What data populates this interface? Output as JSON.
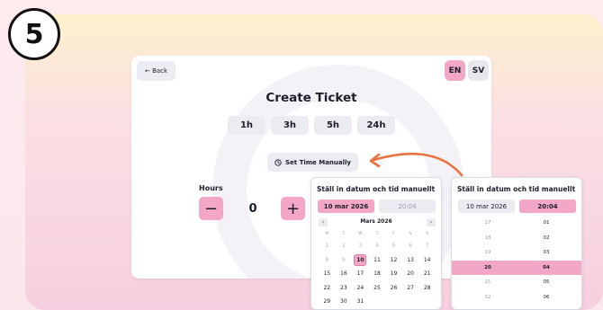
{
  "step_number": "5",
  "header": {
    "back_label": "← Back",
    "lang_en": "EN",
    "lang_sv": "SV"
  },
  "title": "Create Ticket",
  "durations": [
    "1h",
    "3h",
    "5h",
    "24h"
  ],
  "manual_button": {
    "icon": "clock-icon",
    "label": "Set Time Manually"
  },
  "hours": {
    "label": "Hours",
    "value": "0",
    "minus": "−",
    "plus": "+"
  },
  "date_picker": {
    "title": "Ställ in datum och tid manuellt",
    "date_chip": "10 mar 2026",
    "time_chip": "20:04",
    "month_label": "Mars 2026",
    "prev": "‹",
    "next": "›",
    "weekdays": [
      "M",
      "T",
      "W",
      "T",
      "F",
      "S",
      "S"
    ],
    "weeks": [
      [
        "1",
        "2",
        "3",
        "4",
        "5",
        "6",
        "7"
      ],
      [
        "8",
        "9",
        "10",
        "11",
        "12",
        "13",
        "14"
      ],
      [
        "15",
        "16",
        "17",
        "18",
        "19",
        "20",
        "21"
      ],
      [
        "22",
        "23",
        "24",
        "25",
        "26",
        "27",
        "28"
      ],
      [
        "29",
        "30",
        "31",
        "",
        "",
        "",
        ""
      ]
    ],
    "selected_day": "10"
  },
  "time_picker": {
    "title": "Ställ in datum och tid manuellt",
    "date_chip": "10 mar 2026",
    "time_chip": "20:04",
    "rows": [
      {
        "hour": "17",
        "minute": "01"
      },
      {
        "hour": "18",
        "minute": "02"
      },
      {
        "hour": "19",
        "minute": "03"
      },
      {
        "hour": "20",
        "minute": "04"
      },
      {
        "hour": "21",
        "minute": "05"
      },
      {
        "hour": "22",
        "minute": "06"
      }
    ],
    "selected_row": 3
  },
  "colors": {
    "accent": "#f2a7c6",
    "arrow": "#e8733f"
  }
}
